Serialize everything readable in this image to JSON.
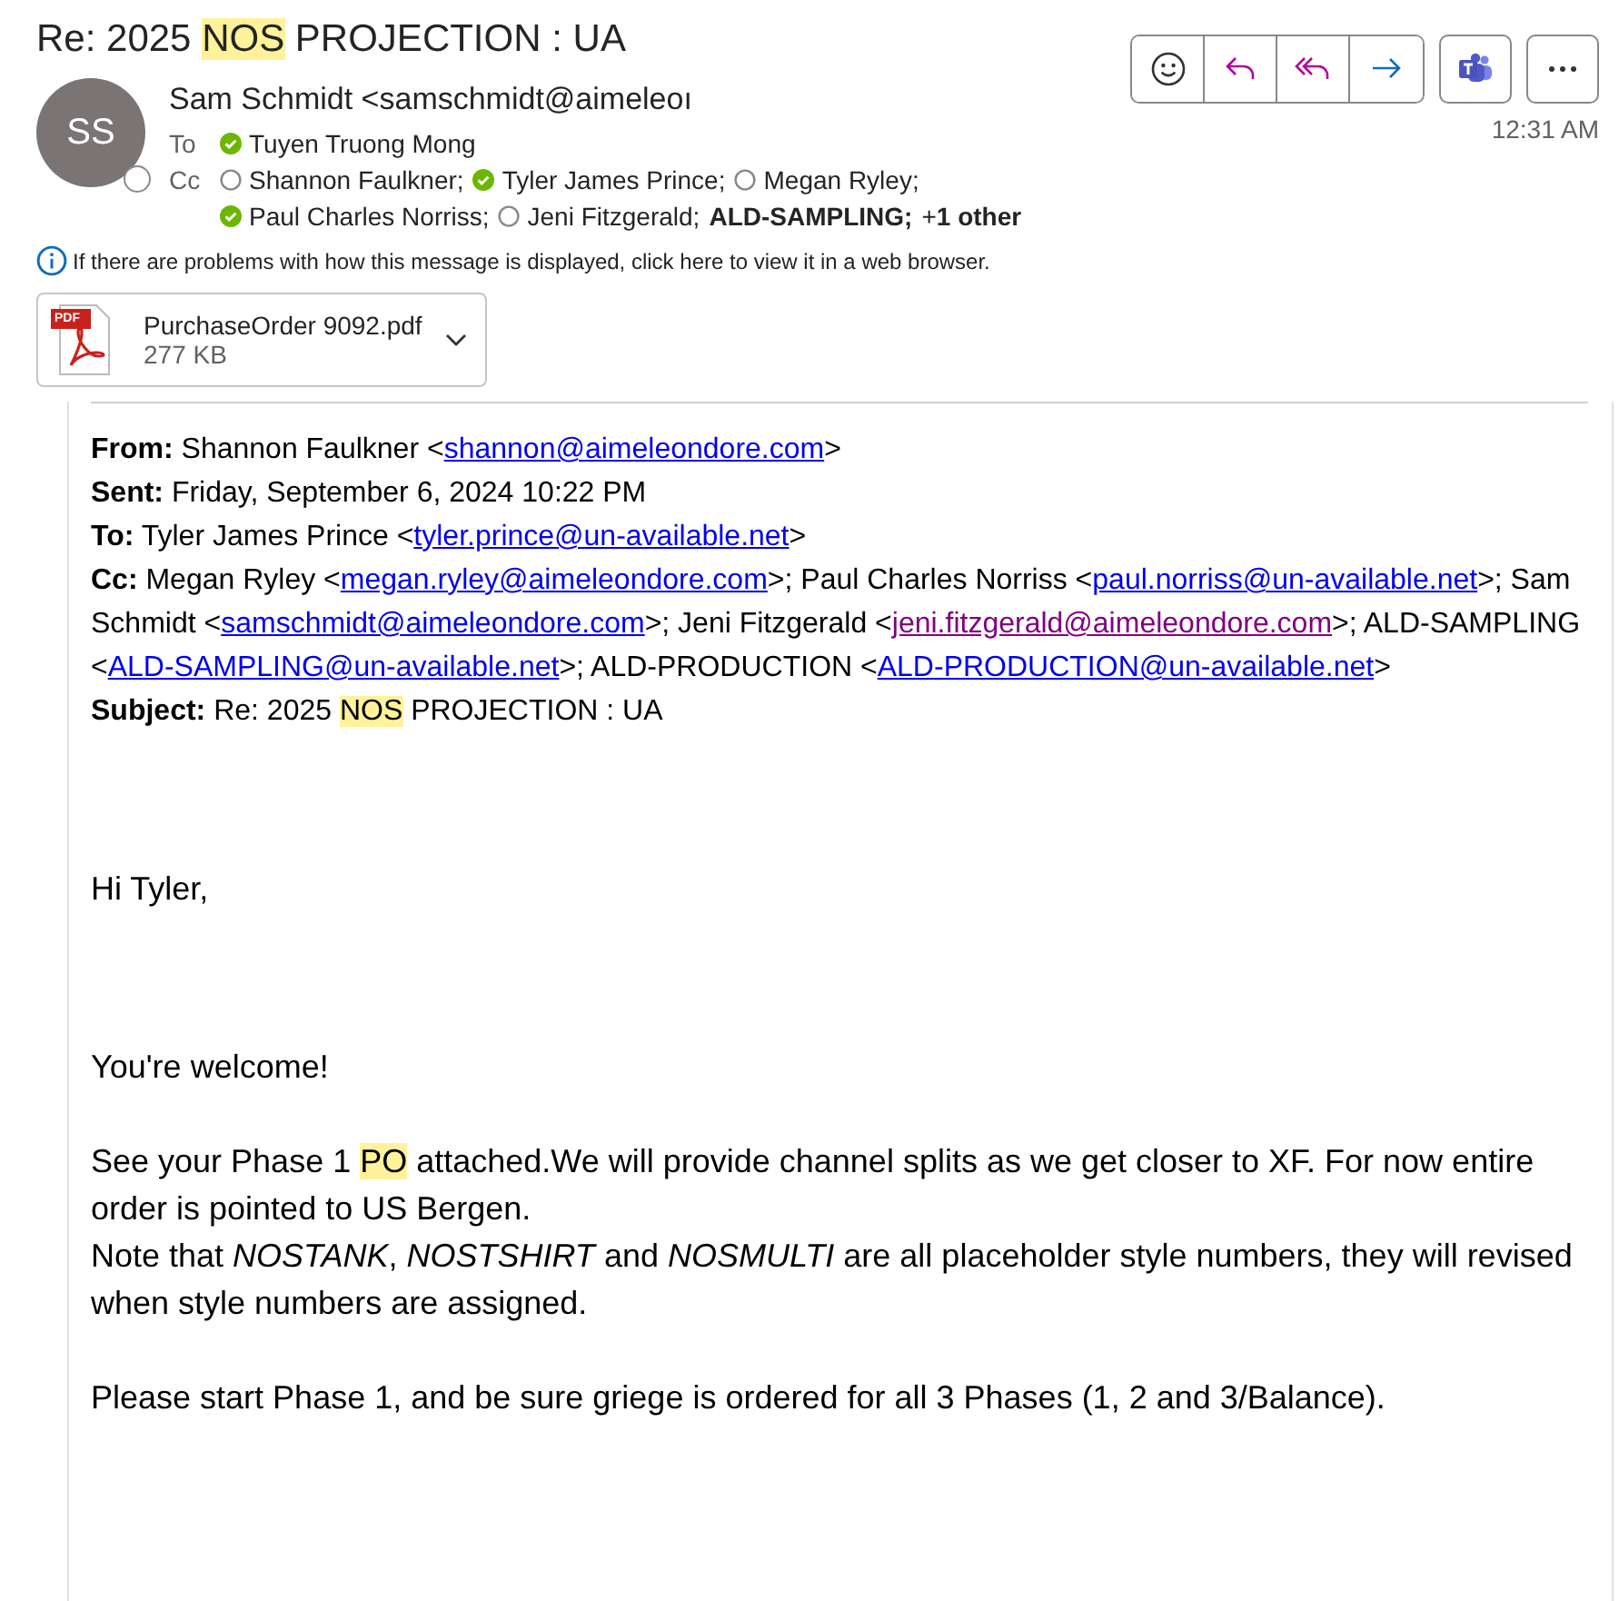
{
  "subject": [
    {
      "text": "Re: 2025 "
    },
    {
      "text": "NOS",
      "highlighted": true
    },
    {
      "text": " PROJECTION : UA"
    }
  ],
  "sender": {
    "initials": "SS",
    "name": "Sam Schmidt <samschmidt@aimeleoı",
    "time": "12:31 AM"
  },
  "to": {
    "label": "To",
    "recipients": [
      {
        "name": "Tuyen Truong Mong",
        "available": true
      }
    ]
  },
  "cc": {
    "label": "Cc",
    "recipients": [
      {
        "name": "Shannon Faulkner;",
        "available": false
      },
      {
        "name": "Tyler James Prince;",
        "available": true
      },
      {
        "name": "Megan Ryley;",
        "available": false
      },
      {
        "name": "Paul Charles Norriss;",
        "available": true
      },
      {
        "name": "Jeni Fitzgerald;",
        "available": false
      },
      {
        "name": "ALD-SAMPLING;",
        "bold": true
      },
      {
        "name": "+**1 other**"
      }
    ]
  },
  "info": "If there are problems with how this message is displayed, click here to view it in a web browser.",
  "attachment": {
    "name": "PurchaseOrder 9092.pdf",
    "size": "277 KB",
    "badge": "PDF"
  },
  "quote": [
    {
      "label": "From:",
      "parts": [
        {
          "text": " Shannon Faulkner <"
        },
        {
          "text": "shannon@aimeleondore.com",
          "link": true
        },
        {
          "text": ">"
        }
      ]
    },
    {
      "label": "Sent:",
      "parts": [
        {
          "text": " Friday, September 6, 2024 10:22 PM"
        }
      ]
    },
    {
      "label": "To:",
      "parts": [
        {
          "text": " Tyler James Prince <"
        },
        {
          "text": "tyler.prince@un-available.net",
          "link": true
        },
        {
          "text": ">"
        }
      ]
    },
    {
      "label": "Cc:",
      "parts": [
        {
          "text": " Megan Ryley <"
        },
        {
          "text": "megan.ryley@aimeleondore.com",
          "link": true
        },
        {
          "text": ">; Paul Charles Norriss <"
        },
        {
          "text": "paul.norriss@un-available.net",
          "link": true
        },
        {
          "text": ">; Sam Schmidt <"
        },
        {
          "text": "samschmidt@aimeleondore.com",
          "link": true
        },
        {
          "text": ">; Jeni Fitzgerald <"
        },
        {
          "text": "jeni.fitzgerald@aimeleondore.com",
          "link": true,
          "visited": true
        },
        {
          "text": ">; ALD-SAMPLING <"
        },
        {
          "text": "ALD-SAMPLING@un-available.net",
          "link": true
        },
        {
          "text": ">; ALD-PRODUCTION <"
        },
        {
          "text": "ALD-PRODUCTION@un-available.net",
          "link": true
        },
        {
          "text": ">"
        }
      ]
    },
    {
      "label": "Subject:",
      "parts": [
        {
          "text": " Re: 2025 "
        },
        {
          "text": "NOS",
          "highlighted": true
        },
        {
          "text": " PROJECTION : UA"
        }
      ]
    }
  ],
  "body": [
    {
      "parts": [
        {
          "text": "Hi Tyler,"
        }
      ]
    },
    {
      "parts": [
        {
          "text": "You're welcome!"
        }
      ]
    },
    {
      "parts": [
        {
          "text": "See your Phase 1 "
        },
        {
          "text": "PO",
          "highlighted": true
        },
        {
          "text": " attached.We will provide channel splits as we get closer to XF. For now entire order is pointed to US Bergen."
        }
      ]
    },
    {
      "parts": [
        {
          "text": "Note that *NOSTANK*, *NOSTSHIRT* and *NOSMULTI* are all placeholder style numbers, they will revised when style numbers are assigned."
        }
      ]
    },
    {
      "parts": [
        {
          "text": "Please start Phase 1, and be sure griege is ordered for all 3 Phases (1, 2 and 3/Balance)."
        }
      ]
    }
  ]
}
